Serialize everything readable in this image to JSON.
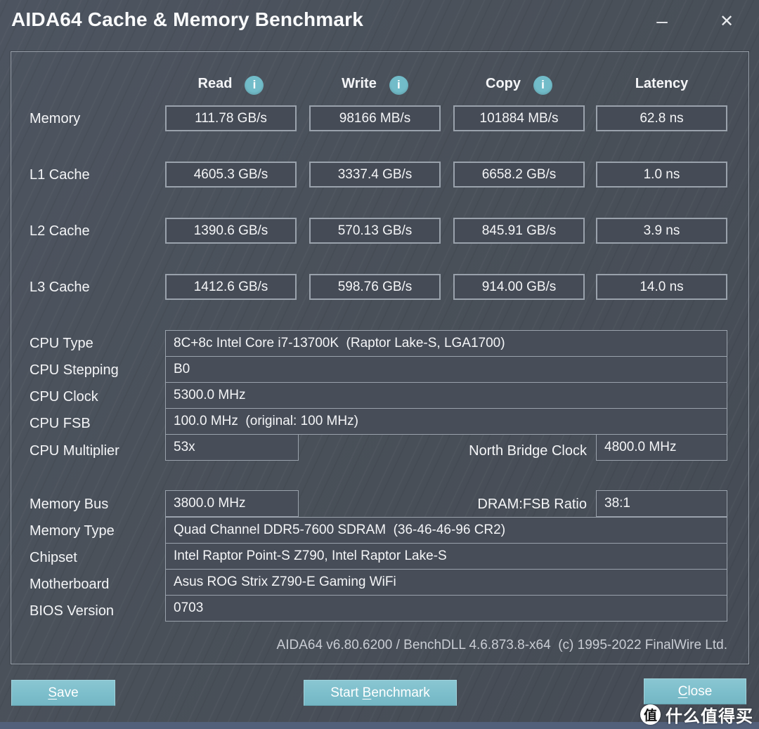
{
  "window": {
    "title": "AIDA64 Cache & Memory Benchmark",
    "minimize_icon": "–",
    "close_icon": "✕"
  },
  "colors": {
    "background": "#4a515c",
    "field_fill": "#454b56",
    "field_border": "#9aa2ac",
    "accent_teal_button": "#7cbecb",
    "info_icon_teal": "#72bcc9",
    "footer_text": "#c9cdd4",
    "bottom_strip": "#52607a"
  },
  "benchmark": {
    "columns": [
      {
        "label": "Read",
        "has_info_icon": true
      },
      {
        "label": "Write",
        "has_info_icon": true
      },
      {
        "label": "Copy",
        "has_info_icon": true
      },
      {
        "label": "Latency",
        "has_info_icon": false
      }
    ],
    "info_icon_glyph": "i",
    "rows": [
      {
        "label": "Memory",
        "values": [
          "111.78 GB/s",
          "98166 MB/s",
          "101884 MB/s",
          "62.8 ns"
        ]
      },
      {
        "label": "L1 Cache",
        "values": [
          "4605.3 GB/s",
          "3337.4 GB/s",
          "6658.2 GB/s",
          "1.0 ns"
        ]
      },
      {
        "label": "L2 Cache",
        "values": [
          "1390.6 GB/s",
          "570.13 GB/s",
          "845.91 GB/s",
          "3.9 ns"
        ]
      },
      {
        "label": "L3 Cache",
        "values": [
          "1412.6 GB/s",
          "598.76 GB/s",
          "914.00 GB/s",
          "14.0 ns"
        ]
      }
    ]
  },
  "cpu_info": {
    "cpu_type": {
      "label": "CPU Type",
      "value": "8C+8c Intel Core i7-13700K  (Raptor Lake-S, LGA1700)"
    },
    "cpu_stepping": {
      "label": "CPU Stepping",
      "value": "B0"
    },
    "cpu_clock": {
      "label": "CPU Clock",
      "value": "5300.0 MHz"
    },
    "cpu_fsb": {
      "label": "CPU FSB",
      "value": "100.0 MHz  (original: 100 MHz)"
    },
    "cpu_multiplier": {
      "label": "CPU Multiplier",
      "value": "53x"
    },
    "north_bridge": {
      "label": "North Bridge Clock",
      "value": "4800.0 MHz"
    }
  },
  "memory_info": {
    "memory_bus": {
      "label": "Memory Bus",
      "value": "3800.0 MHz"
    },
    "dram_fsb_ratio": {
      "label": "DRAM:FSB Ratio",
      "value": "38:1"
    },
    "memory_type": {
      "label": "Memory Type",
      "value": "Quad Channel DDR5-7600 SDRAM  (36-46-46-96 CR2)"
    },
    "chipset": {
      "label": "Chipset",
      "value": "Intel Raptor Point-S Z790, Intel Raptor Lake-S"
    },
    "motherboard": {
      "label": "Motherboard",
      "value": "Asus ROG Strix Z790-E Gaming WiFi"
    },
    "bios_version": {
      "label": "BIOS Version",
      "value": "0703"
    }
  },
  "footer": {
    "version_text": "AIDA64 v6.80.6200 / BenchDLL 4.6.873.8-x64  (c) 1995-2022 FinalWire Ltd."
  },
  "buttons": {
    "save": {
      "pre": "",
      "key": "S",
      "post": "ave"
    },
    "start": {
      "pre": "Start ",
      "key": "B",
      "post": "enchmark"
    },
    "close": {
      "pre": "",
      "key": "C",
      "post": "lose"
    }
  },
  "watermark": {
    "logo_char": "值",
    "text": "什么值得买"
  }
}
